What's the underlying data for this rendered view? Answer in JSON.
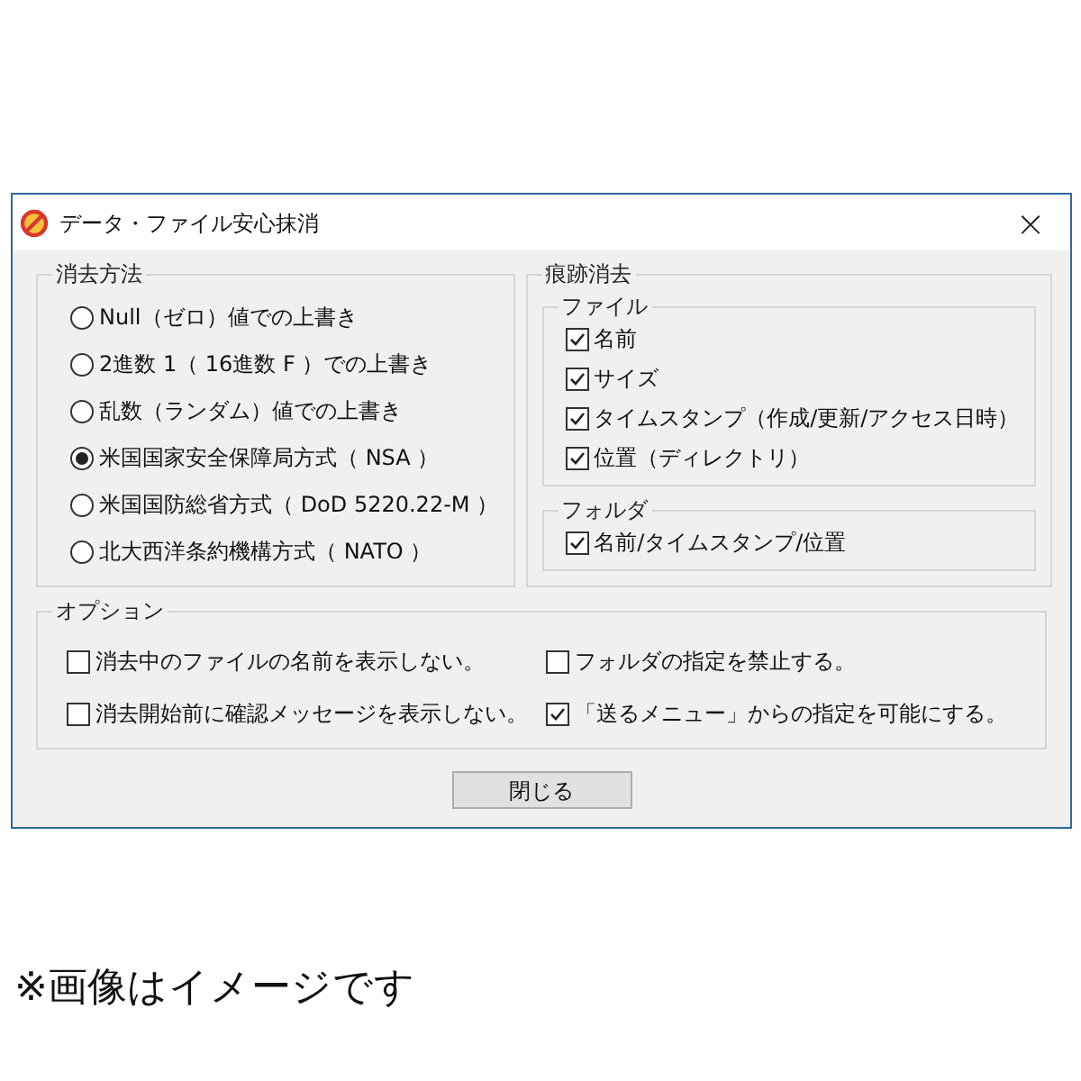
{
  "window": {
    "title": "データ・ファイル安心抹消",
    "close": "×"
  },
  "method_group": {
    "title": "消去方法",
    "options": [
      {
        "label": "Null（ゼロ）値での上書き",
        "selected": false
      },
      {
        "label": "2進数 1（ 16進数 F ）での上書き",
        "selected": false
      },
      {
        "label": "乱数（ランダム）値での上書き",
        "selected": false
      },
      {
        "label": "米国国家安全保障局方式（ NSA ）",
        "selected": true
      },
      {
        "label": "米国国防総省方式（ DoD 5220.22-M ）",
        "selected": false
      },
      {
        "label": "北大西洋条約機構方式（ NATO ）",
        "selected": false
      }
    ]
  },
  "trace_group": {
    "title": "痕跡消去",
    "subgroups": [
      {
        "title": "ファイル",
        "items": [
          {
            "label": "名前",
            "checked": true
          },
          {
            "label": "サイズ",
            "checked": true
          },
          {
            "label": "タイムスタンプ（作成/更新/アクセス日時）",
            "checked": true
          },
          {
            "label": "位置（ディレクトリ）",
            "checked": true
          }
        ]
      },
      {
        "title": "フォルダ",
        "items": [
          {
            "label": "名前/タイムスタンプ/位置",
            "checked": true
          }
        ]
      }
    ]
  },
  "options_group": {
    "title": "オプション",
    "items": [
      {
        "label": "消去中のファイルの名前を表示しない。",
        "checked": false
      },
      {
        "label": "フォルダの指定を禁止する。",
        "checked": false
      },
      {
        "label": "消去開始前に確認メッセージを表示しない。",
        "checked": false
      },
      {
        "label": "「送るメニュー」からの指定を可能にする。",
        "checked": true
      }
    ]
  },
  "buttons": [
    "閉じる"
  ],
  "caption": "※画像はイメージです"
}
